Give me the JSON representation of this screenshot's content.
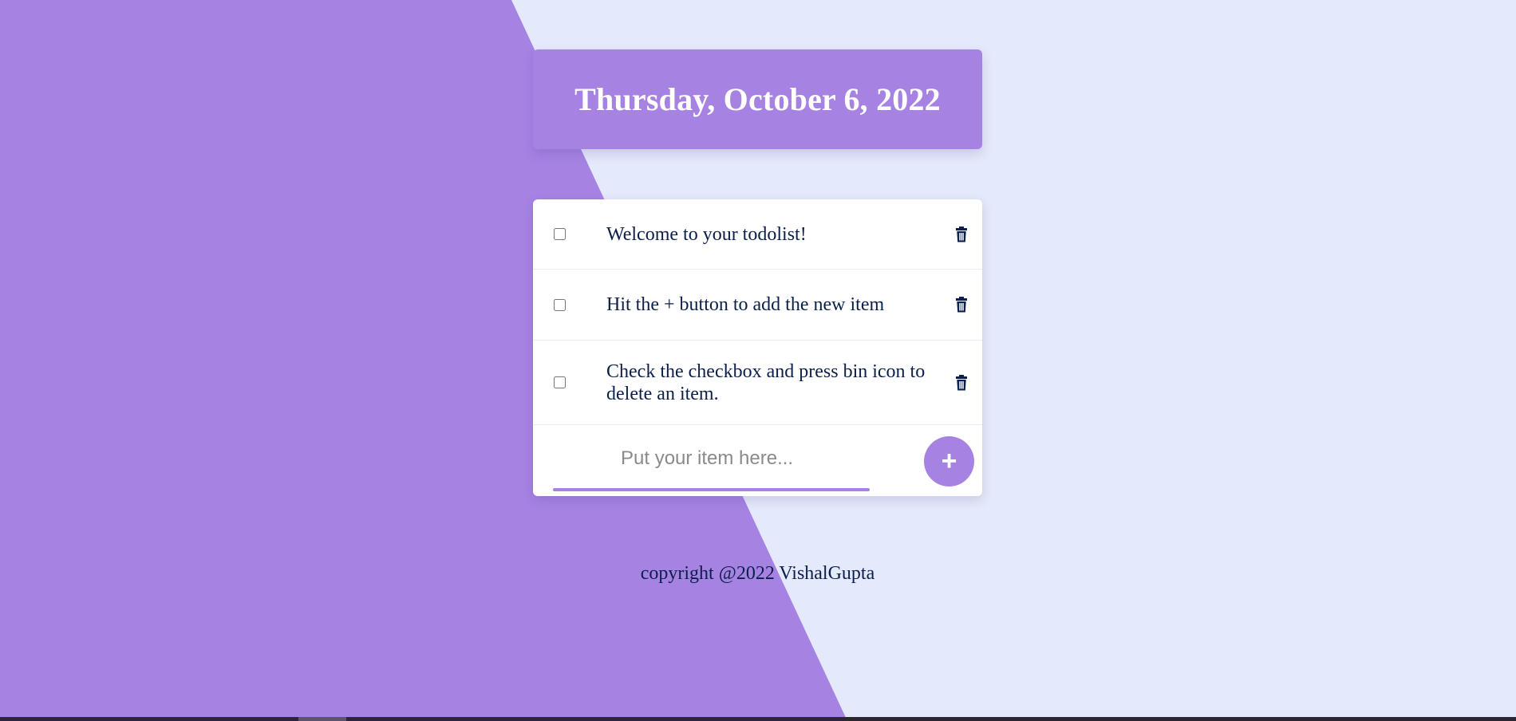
{
  "colors": {
    "accent": "#a683e3",
    "background": "#e4e9fb",
    "text": "#0b1f4b",
    "card": "#ffffff"
  },
  "header": {
    "date_title": "Thursday, October 6, 2022"
  },
  "todo": {
    "items": [
      {
        "text": "Welcome to your todolist!",
        "checked": false,
        "delete_icon": "trash-icon"
      },
      {
        "text": "Hit the + button to add the new item",
        "checked": false,
        "delete_icon": "trash-icon"
      },
      {
        "text": "Check the checkbox and press bin icon to delete an item.",
        "checked": false,
        "delete_icon": "trash-icon"
      }
    ],
    "input": {
      "value": "",
      "placeholder": "Put your item here..."
    },
    "add_button_label": "+"
  },
  "footer": {
    "copyright": "copyright @2022 VishalGupta"
  }
}
